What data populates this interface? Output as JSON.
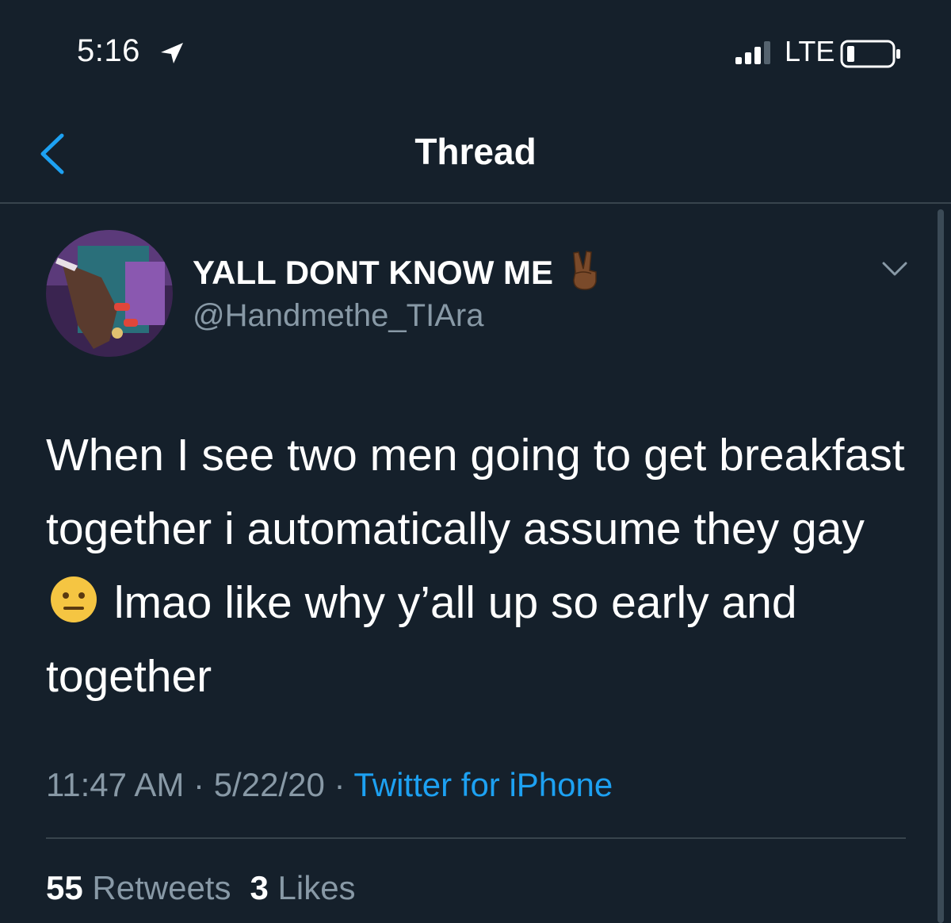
{
  "status": {
    "time": "5:16",
    "network": "LTE"
  },
  "nav": {
    "title": "Thread"
  },
  "tweet": {
    "display_name": "YALL DONT KNOW ME",
    "handle": "@Handmethe_TIAra",
    "text_before_emoji": "When I see two men going to get breakfast together i automatically assume they gay",
    "text_after_emoji": " lmao like why y’all up so early and together",
    "time": "11:47 AM",
    "date": "5/22/20",
    "source": "Twitter for iPhone",
    "separator": "·",
    "retweets_count": "55",
    "retweets_label": "Retweets",
    "likes_count": "3",
    "likes_label": "Likes"
  },
  "icons": {
    "location": "location-arrow-icon",
    "signal": "signal-bars-icon",
    "battery": "battery-icon",
    "back": "back-chevron-icon",
    "more": "chevron-down-icon",
    "peace": "victory-hand-emoji",
    "neutral": "neutral-face-emoji"
  },
  "colors": {
    "background": "#15202b",
    "accent": "#1da1f2",
    "muted": "#8899a6"
  }
}
